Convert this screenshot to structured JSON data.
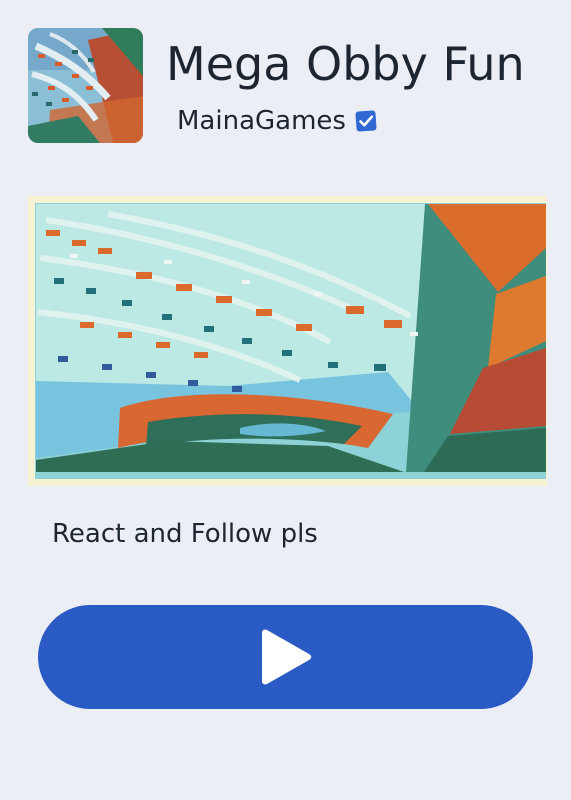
{
  "game": {
    "title": "Mega Obby Fun",
    "creator": "MainaGames",
    "description": "React and Follow pls"
  },
  "icons": {
    "verified": "verified-badge-icon",
    "play": "play-icon"
  },
  "colors": {
    "background": "#eceef6",
    "accent": "#2a5ac3",
    "text": "#1c2530",
    "verified": "#2f68d3"
  }
}
